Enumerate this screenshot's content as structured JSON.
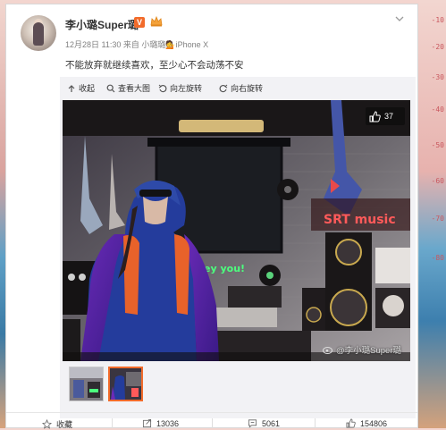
{
  "post": {
    "username": "李小璐Super璐",
    "vip_badge": "V",
    "meta": "12月28日 11:30 来自 小璐璐💁iPhone X",
    "text": "不能放弃就继续喜欢，至少心不会动荡不安"
  },
  "toolbar": {
    "collapse": "收起",
    "view_large": "查看大图",
    "rotate_left": "向左旋转",
    "rotate_right": "向右旋转"
  },
  "photo": {
    "like_count": "37",
    "neon_sign_1": "SRT music",
    "neon_sign_2": "ey you!",
    "watermark": "@李小璐Super璐"
  },
  "actions": {
    "favorite": "收藏",
    "repost": "13036",
    "comment": "5061",
    "like": "154806"
  },
  "ruler": [
    "-10",
    "-20",
    "-30",
    "-40",
    "-50",
    "-60",
    "-70",
    "-80"
  ],
  "colors": {
    "accent": "#f26b2a"
  }
}
